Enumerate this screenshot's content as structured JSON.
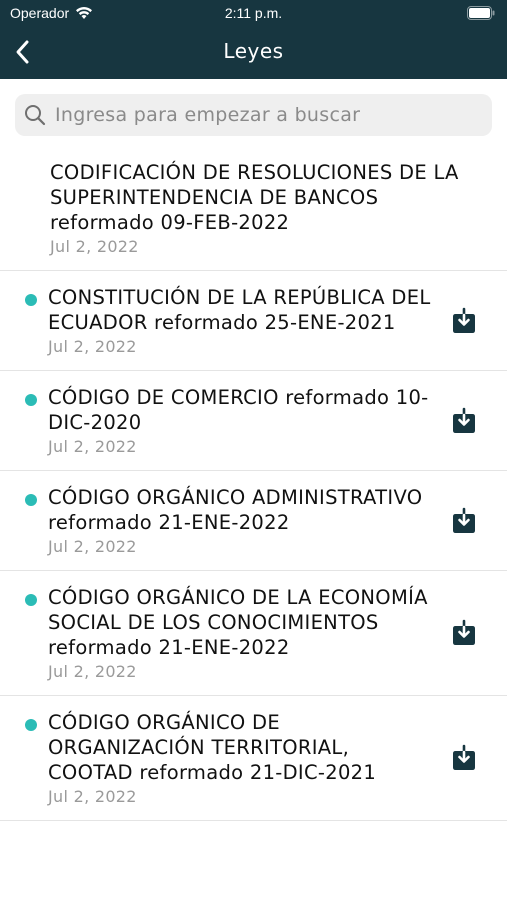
{
  "status_bar": {
    "carrier": "Operador",
    "time": "2:11 p.m."
  },
  "header": {
    "title": "Leyes"
  },
  "search": {
    "placeholder": "Ingresa para empezar a buscar"
  },
  "colors": {
    "header_bg": "#173640",
    "dot": "#2bbcb6",
    "icon": "#173640"
  },
  "laws": [
    {
      "name": "CODIFICACIÓN DE RESOLUCIONES DE LA SUPERINTENDENCIA DE BANCOS reformado 09-FEB-2022",
      "date": "Jul 2, 2022",
      "downloaded": true
    },
    {
      "name": "CONSTITUCIÓN DE LA REPÚBLICA DEL ECUADOR reformado 25-ENE-2021",
      "date": "Jul 2, 2022",
      "downloaded": false
    },
    {
      "name": "CÓDIGO DE COMERCIO reformado 10-DIC-2020",
      "date": "Jul 2, 2022",
      "downloaded": false
    },
    {
      "name": "CÓDIGO ORGÁNICO ADMINISTRATIVO reformado 21-ENE-2022",
      "date": "Jul 2, 2022",
      "downloaded": false
    },
    {
      "name": "CÓDIGO ORGÁNICO DE LA ECONOMÍA SOCIAL DE LOS CONOCIMIENTOS reformado 21-ENE-2022",
      "date": "Jul 2, 2022",
      "downloaded": false
    },
    {
      "name": "CÓDIGO ORGÁNICO DE ORGANIZACIÓN TERRITORIAL, COOTAD reformado 21-DIC-2021",
      "date": "Jul 2, 2022",
      "downloaded": false
    }
  ]
}
